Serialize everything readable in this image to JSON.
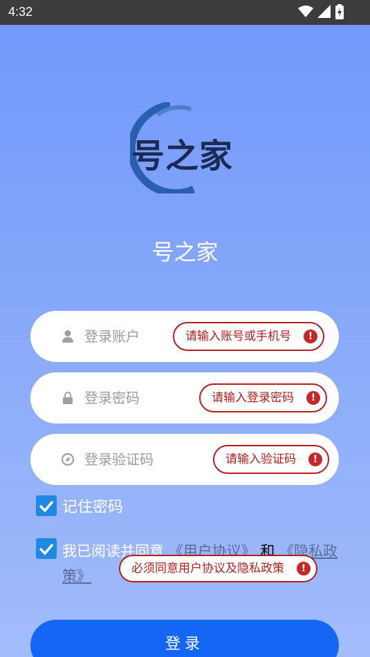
{
  "status_bar": {
    "time": "4:32"
  },
  "logo": {
    "text": "号之家"
  },
  "app_name": "号之家",
  "fields": {
    "account": {
      "placeholder": "登录账户",
      "tip": "请输入账号或手机号"
    },
    "password": {
      "placeholder": "登录密码",
      "tip": "请输入登录密码"
    },
    "captcha": {
      "placeholder": "登录验证码",
      "tip": "请输入验证码"
    }
  },
  "remember": {
    "label": "记住密码",
    "checked": true
  },
  "agreement": {
    "checked": true,
    "prefix": "我已阅读并同意",
    "user_agreement": "《用户协议》",
    "and": "和",
    "privacy_policy": "《隐私政策》",
    "tip": "必须同意用户协议及隐私政策"
  },
  "login_button": {
    "label": "登录"
  },
  "colors": {
    "accent": "#1666f5",
    "error": "#b71c1c",
    "checkbox": "#1e88e5",
    "logo_ring": "#2a5fb0"
  }
}
